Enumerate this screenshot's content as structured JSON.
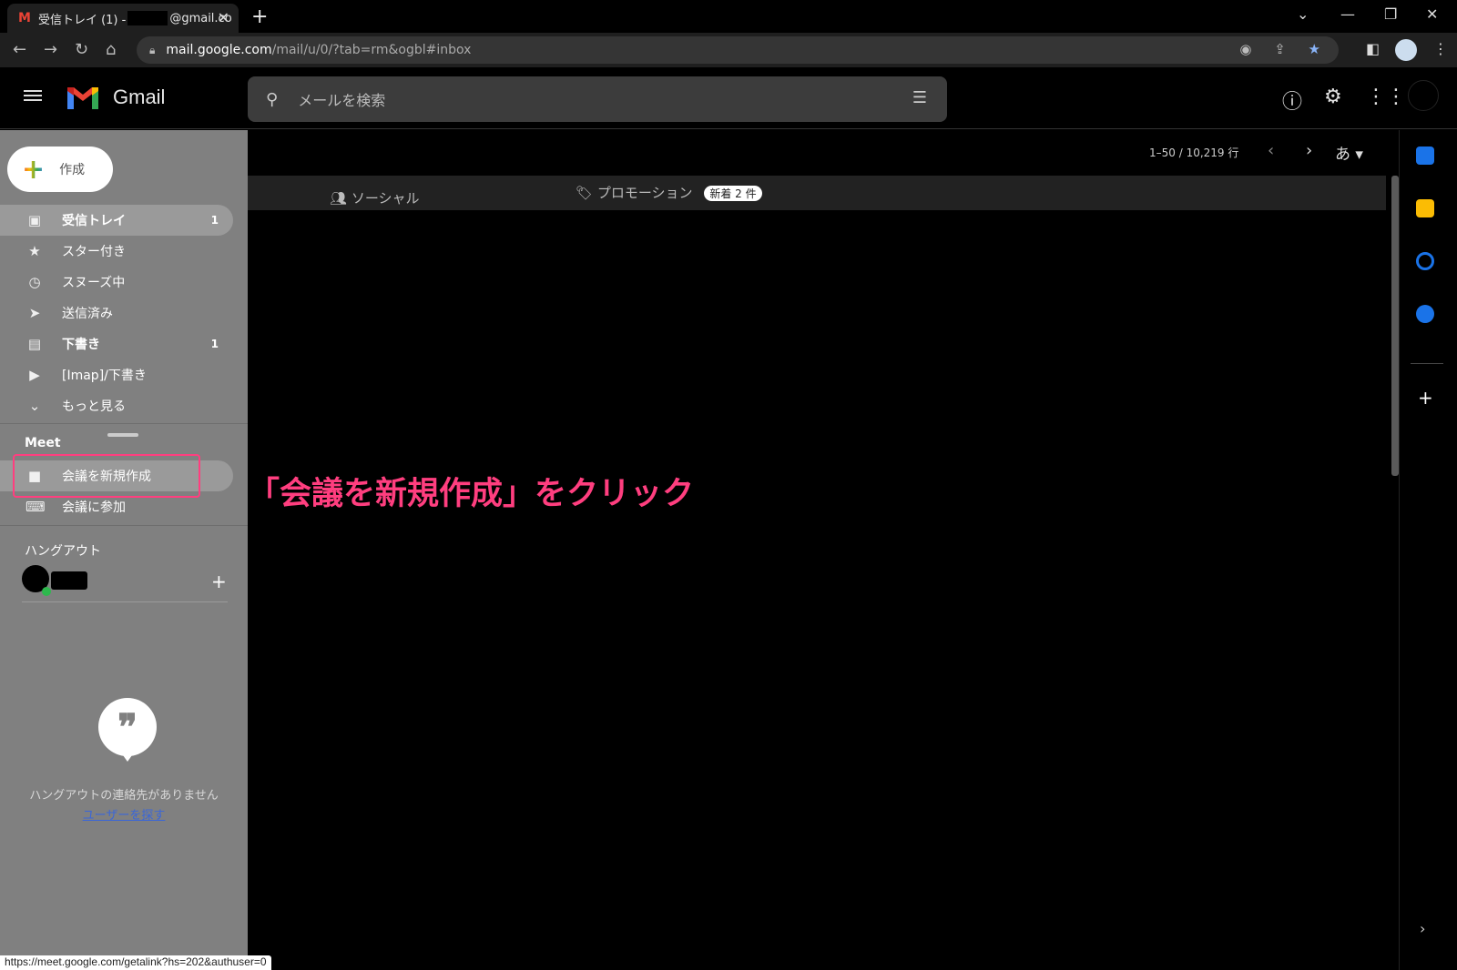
{
  "browser": {
    "tab_title_prefix": "受信トレイ (1) -",
    "tab_title_suffix": "@gmail.co",
    "url_domain": "mail.google.com",
    "url_path": "/mail/u/0/?tab=rm&ogbl#inbox",
    "status_url": "https://meet.google.com/getalink?hs=202&authuser=0"
  },
  "header": {
    "app_name": "Gmail",
    "search_placeholder": "メールを検索"
  },
  "sidebar": {
    "compose_label": "作成",
    "items": [
      {
        "label": "受信トレイ",
        "count": "1",
        "icon": "inbox-icon"
      },
      {
        "label": "スター付き",
        "count": "",
        "icon": "star-icon"
      },
      {
        "label": "スヌーズ中",
        "count": "",
        "icon": "clock-icon"
      },
      {
        "label": "送信済み",
        "count": "",
        "icon": "send-icon"
      },
      {
        "label": "下書き",
        "count": "1",
        "icon": "draft-icon"
      },
      {
        "label": "[Imap]/下書き",
        "count": "",
        "icon": "label-icon"
      },
      {
        "label": "もっと見る",
        "count": "",
        "icon": "chevron-down-icon"
      }
    ],
    "meet_title": "Meet",
    "meet_items": [
      {
        "label": "会議を新規作成",
        "icon": "video-icon"
      },
      {
        "label": "会議に参加",
        "icon": "keyboard-icon"
      }
    ],
    "hangouts_title": "ハングアウト",
    "no_contacts": "ハングアウトの連絡先がありません",
    "find_users": "ユーザーを探す"
  },
  "main": {
    "pagination": "1–50 / 10,219 行",
    "input_tool": "あ",
    "tabs": {
      "social": "ソーシャル",
      "promotions": "プロモーション",
      "promotions_badge": "新着 2 件"
    }
  },
  "annotation": "「会議を新規作成」をクリック",
  "colors": {
    "highlight": "#ff3e7f",
    "sidebar_bg": "#808080"
  }
}
